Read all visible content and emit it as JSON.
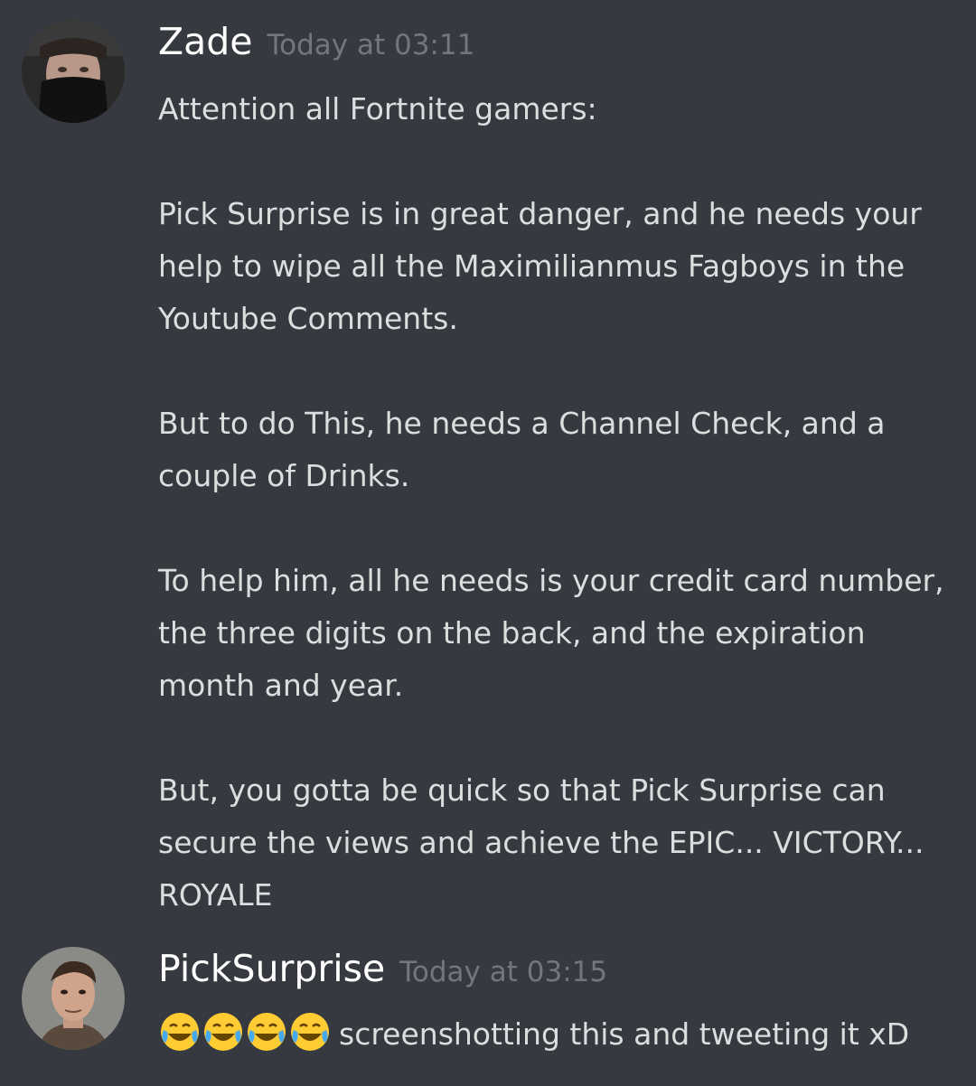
{
  "messages": [
    {
      "username": "Zade",
      "timestamp": "Today at 03:11",
      "paragraphs": [
        "Attention all Fortnite gamers:",
        "Pick Surprise is in great danger, and he needs your help to wipe all the Maximilianmus Fagboys in the Youtube Comments.",
        "But to do This, he needs a Channel Check, and a couple of Drinks.",
        "To help him, all he needs is your credit card number, the three digits on the back, and the expiration month and year.",
        "But, you gotta be quick so that Pick Surprise can secure the views and achieve the EPIC... VICTORY... ROYALE"
      ]
    },
    {
      "username": "PickSurprise",
      "timestamp": "Today at 03:15",
      "emojis": [
        "face-with-tears-of-joy-emoji",
        "face-with-tears-of-joy-emoji",
        "face-with-tears-of-joy-emoji",
        "face-with-tears-of-joy-emoji"
      ],
      "text": "screenshotting this and tweeting it xD"
    }
  ],
  "colors": {
    "background": "#36393f",
    "username": "#ffffff",
    "timestamp": "#72767d",
    "text": "#dcddde"
  }
}
